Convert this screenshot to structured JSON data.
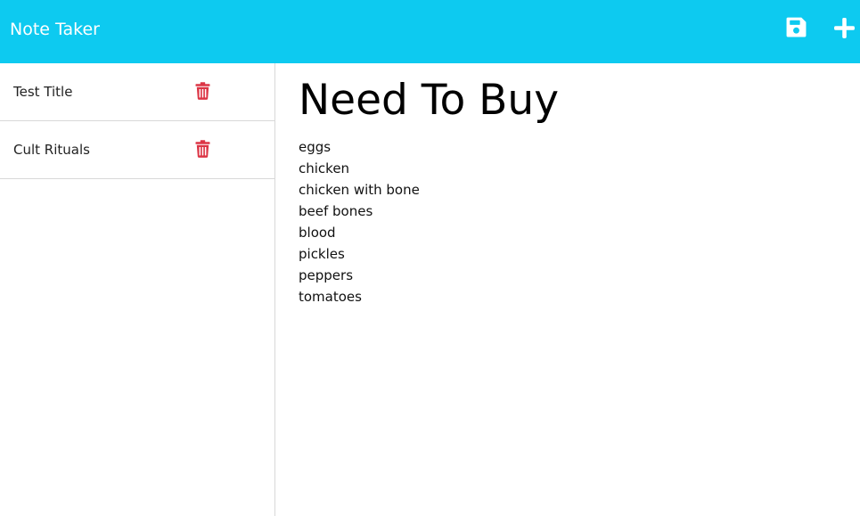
{
  "app": {
    "title": "Note Taker"
  },
  "toolbar": {
    "save_icon": "save-icon",
    "new_icon": "plus-icon",
    "accent_color": "#0dcaf0"
  },
  "sidebar": {
    "notes": [
      {
        "title": "Test Title",
        "delete_icon": "trash-icon"
      },
      {
        "title": "Cult Rituals",
        "delete_icon": "trash-icon"
      }
    ],
    "delete_color": "#dc3545"
  },
  "editor": {
    "title": "Need To Buy",
    "lines": [
      "eggs",
      "chicken",
      "chicken with bone",
      "beef bones",
      "blood",
      "pickles",
      "peppers",
      "tomatoes"
    ]
  }
}
